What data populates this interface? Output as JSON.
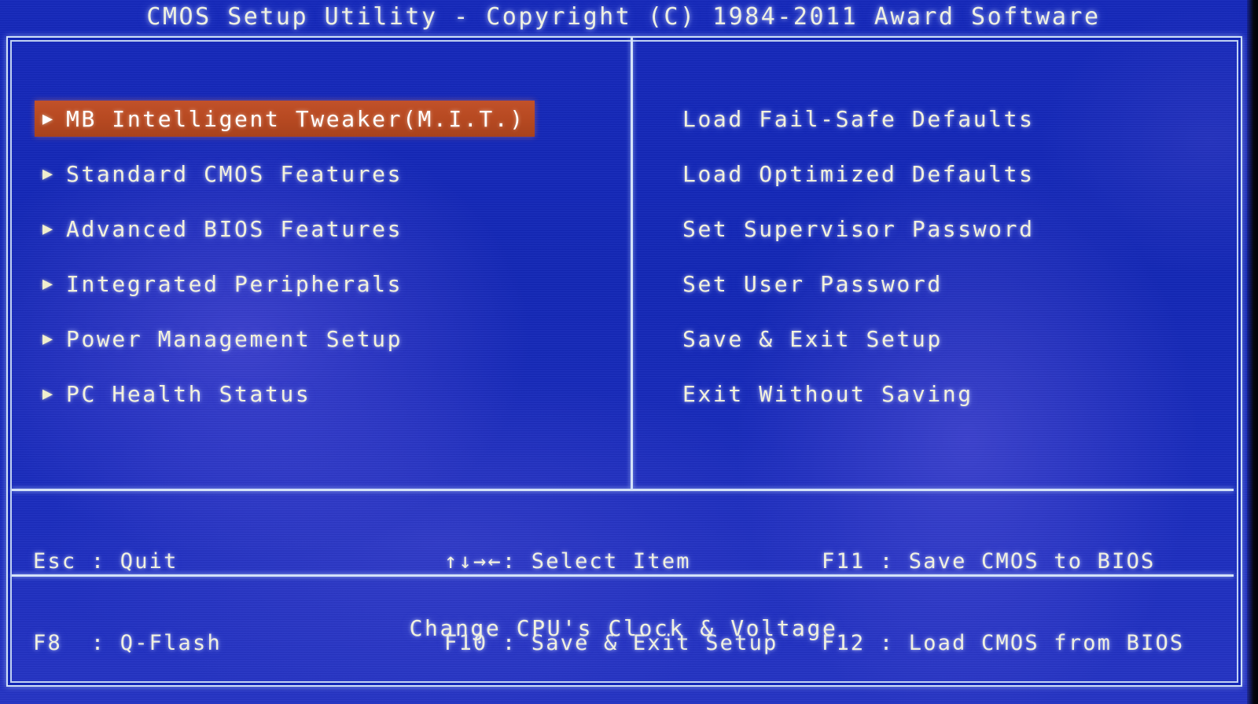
{
  "header": {
    "title": "CMOS Setup Utility - Copyright (C) 1984-2011 Award Software"
  },
  "colors": {
    "background_blue": "#1327b6",
    "frame_line": "#d4e2f8",
    "menu_text": "#f2f1dc",
    "highlight_bar": "#b84a22",
    "highlight_text": "#ffffff"
  },
  "menu": {
    "left": [
      {
        "arrow": "▶",
        "label": "MB Intelligent Tweaker(M.I.T.)",
        "selected": true
      },
      {
        "arrow": "▶",
        "label": "Standard CMOS Features",
        "selected": false
      },
      {
        "arrow": "▶",
        "label": "Advanced BIOS Features",
        "selected": false
      },
      {
        "arrow": "▶",
        "label": "Integrated Peripherals",
        "selected": false
      },
      {
        "arrow": "▶",
        "label": "Power Management Setup",
        "selected": false
      },
      {
        "arrow": "▶",
        "label": "PC Health Status",
        "selected": false
      }
    ],
    "right": [
      {
        "label": "Load Fail-Safe Defaults",
        "selected": false
      },
      {
        "label": "Load Optimized Defaults",
        "selected": false
      },
      {
        "label": "Set Supervisor Password",
        "selected": false
      },
      {
        "label": "Set User Password",
        "selected": false
      },
      {
        "label": "Save & Exit Setup",
        "selected": false
      },
      {
        "label": "Exit Without Saving",
        "selected": false
      }
    ]
  },
  "help": {
    "group1": {
      "line1": "Esc : Quit",
      "line2": "F8  : Q-Flash"
    },
    "group2": {
      "line1": "↑↓→←: Select Item",
      "line2": "F10 : Save & Exit Setup"
    },
    "group3": {
      "line1": "F11 : Save CMOS to BIOS",
      "line2": "F12 : Load CMOS from BIOS"
    }
  },
  "status": {
    "message": "Change CPU's Clock & Voltage"
  }
}
